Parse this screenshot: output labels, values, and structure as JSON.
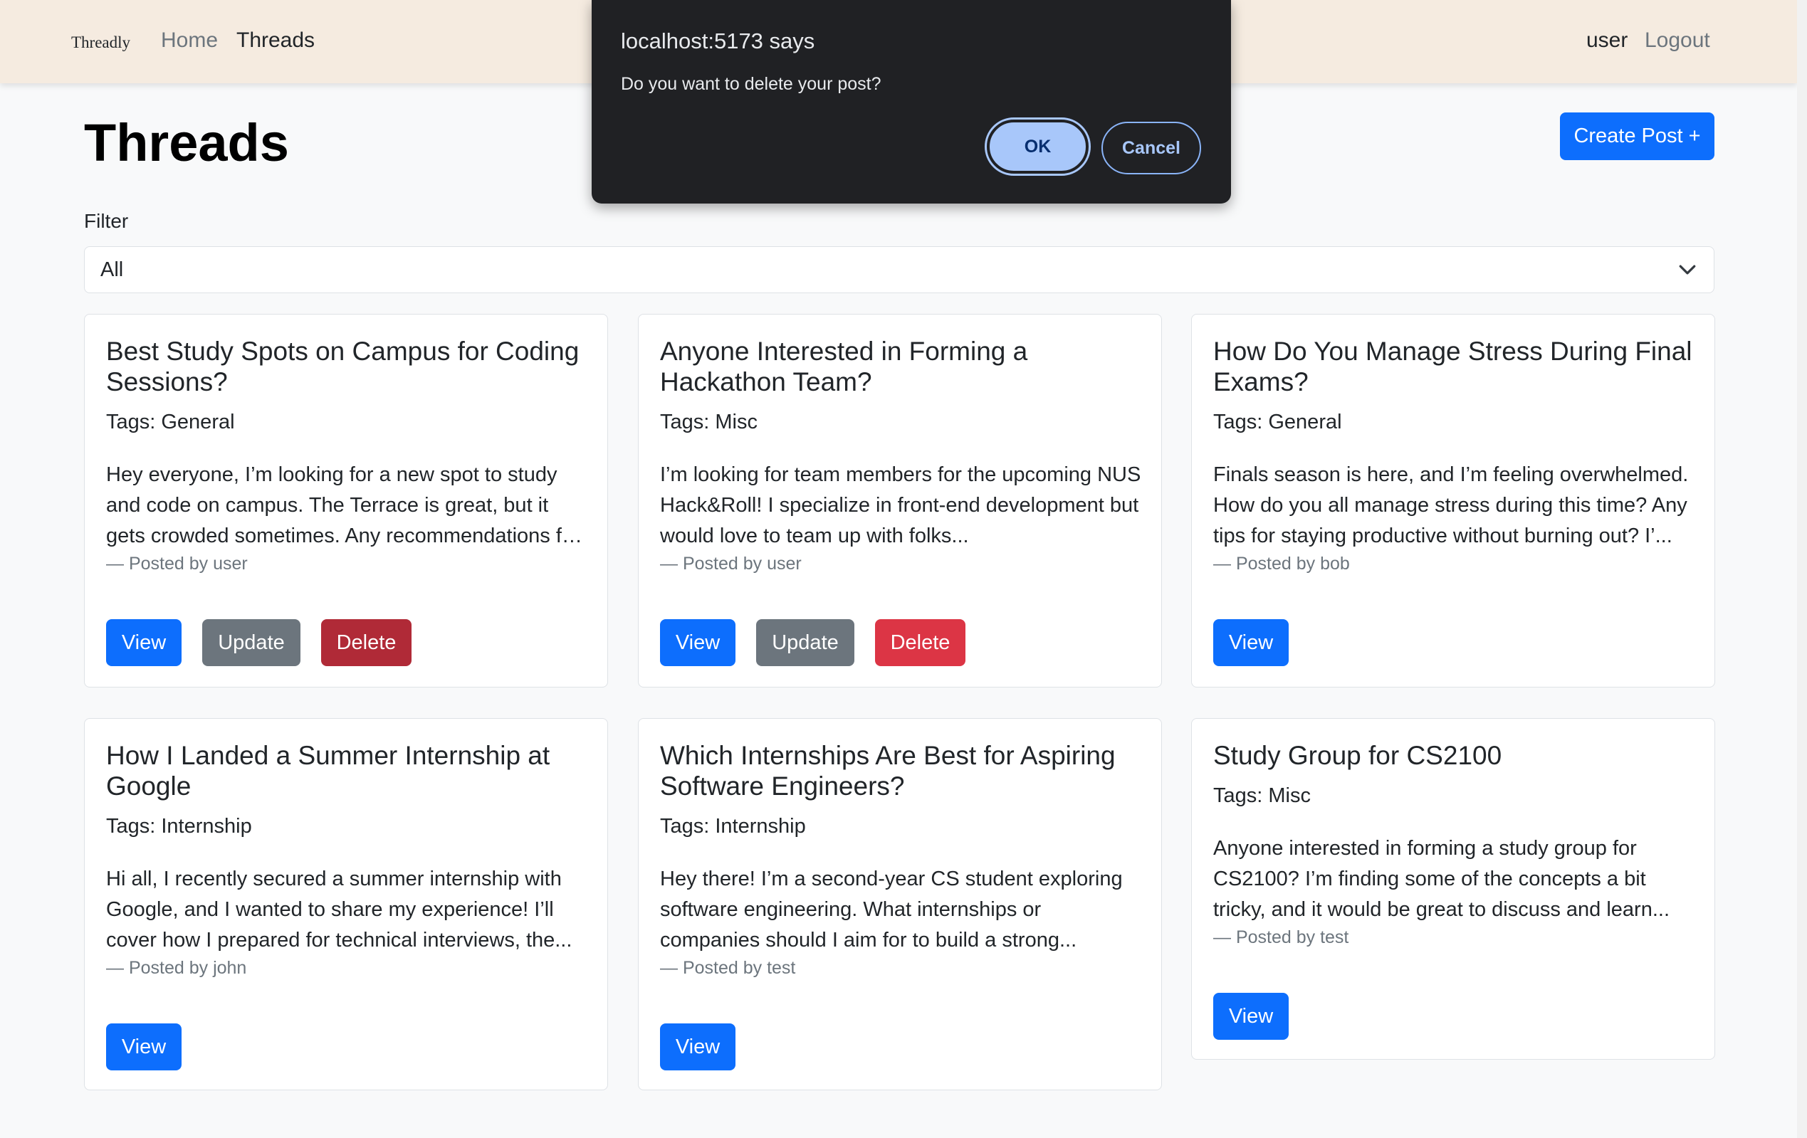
{
  "navbar": {
    "brand": "Threadly",
    "links": [
      {
        "label": "Home"
      },
      {
        "label": "Threads"
      }
    ],
    "user": "user",
    "logout": "Logout"
  },
  "page": {
    "title": "Threads",
    "create_button": "Create Post +",
    "filter_label": "Filter",
    "filter_value": "All"
  },
  "posts": [
    {
      "title": "Best Study Spots on Campus for Coding Sessions?",
      "tags": "Tags: General",
      "body": "Hey everyone, I’m looking for a new spot to study and code on campus. The Terrace is great, but it gets crowded sometimes. Any recommendations for qui...",
      "author": "— Posted by user",
      "view": "View",
      "update": "Update",
      "delete": "Delete"
    },
    {
      "title": "Anyone Interested in Forming a Hackathon Team?",
      "tags": "Tags: Misc",
      "body": "I’m looking for team members for the upcoming NUS Hack&Roll! I specialize in front-end development but would love to team up with folks...",
      "author": "— Posted by user",
      "view": "View",
      "update": "Update",
      "delete": "Delete"
    },
    {
      "title": "How Do You Manage Stress During Final Exams?",
      "tags": "Tags: General",
      "body": "Finals season is here, and I’m feeling overwhelmed. How do you all manage stress during this time? Any tips for staying productive without burning out? I’...",
      "author": "— Posted by bob",
      "view": "View"
    },
    {
      "title": "How I Landed a Summer Internship at Google",
      "tags": "Tags: Internship",
      "body": "Hi all, I recently secured a summer internship with Google, and I wanted to share my experience! I’ll cover how I prepared for technical interviews, the...",
      "author": "— Posted by john",
      "view": "View"
    },
    {
      "title": "Which Internships Are Best for Aspiring Software Engineers?",
      "tags": "Tags: Internship",
      "body": "Hey there! I’m a second-year CS student exploring software engineering. What internships or companies should I aim for to build a strong...",
      "author": "— Posted by test",
      "view": "View"
    },
    {
      "title": "Study Group for CS2100",
      "tags": "Tags: Misc",
      "body": "Anyone interested in forming a study group for CS2100? I’m finding some of the concepts a bit tricky, and it would be great to discuss and learn...",
      "author": "— Posted by test",
      "view": "View"
    }
  ],
  "dialog": {
    "title": "localhost:5173 says",
    "message": "Do you want to delete your post?",
    "ok": "OK",
    "cancel": "Cancel"
  },
  "colors": {
    "navbar_bg": "#f5ebe0",
    "primary": "#0d6efd",
    "secondary": "#6c757d",
    "danger": "#dc3545",
    "dialog_bg": "#202124",
    "dialog_accent": "#a8c7fa"
  }
}
